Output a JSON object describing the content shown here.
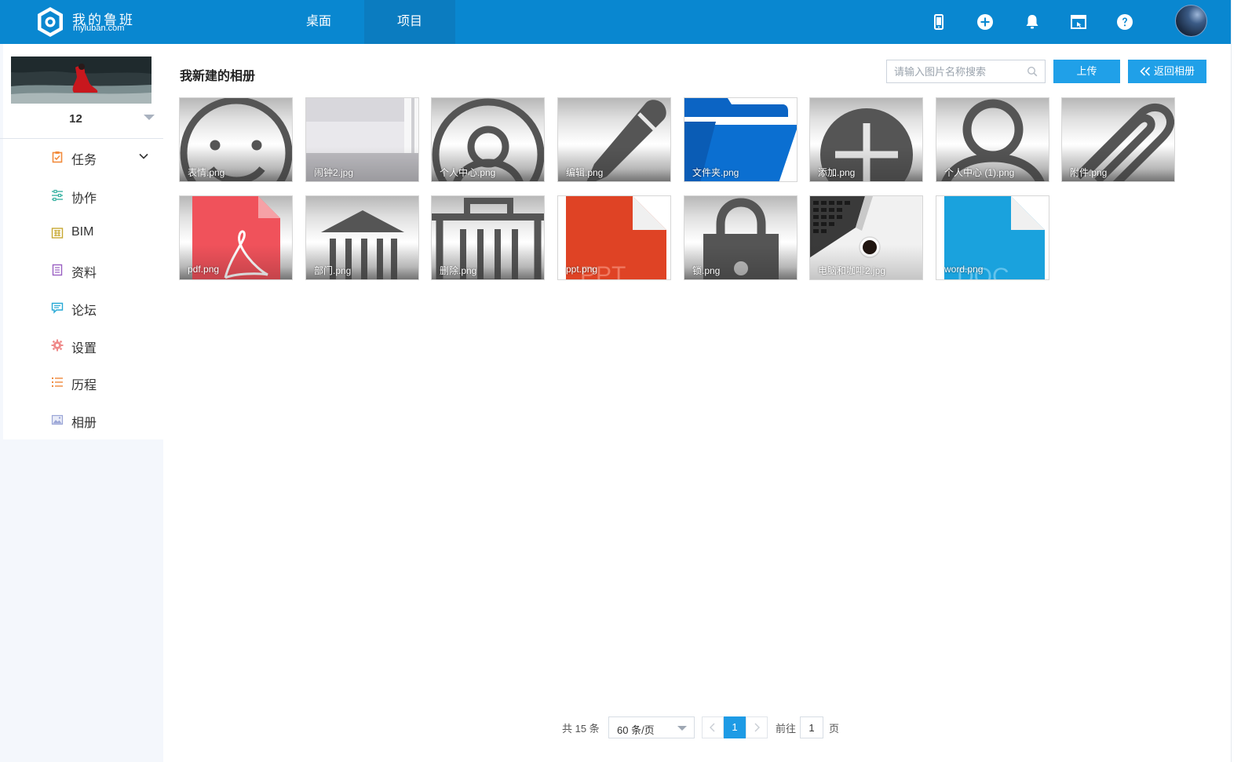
{
  "header": {
    "brand_cn": "我的鲁班",
    "brand_en": "myluban.com",
    "tabs": [
      {
        "label": "桌面",
        "active": false
      },
      {
        "label": "项目",
        "active": true
      }
    ],
    "icons": [
      "mobile-icon",
      "plus-circle-icon",
      "bell-icon",
      "window-icon",
      "help-icon",
      "user-avatar"
    ],
    "accent_color": "#0987d0"
  },
  "sidebar": {
    "project_name": "12",
    "items": [
      {
        "label": "任务",
        "icon": "task-icon",
        "expandable": true
      },
      {
        "label": "协作",
        "icon": "collaborate-icon"
      },
      {
        "label": "BIM",
        "icon": "bim-icon"
      },
      {
        "label": "资料",
        "icon": "documents-icon"
      },
      {
        "label": "论坛",
        "icon": "forum-icon"
      },
      {
        "label": "设置",
        "icon": "settings-icon"
      },
      {
        "label": "历程",
        "icon": "history-icon"
      },
      {
        "label": "相册",
        "icon": "album-icon"
      }
    ]
  },
  "main": {
    "title": "我新建的相册",
    "search_placeholder": "请输入图片名称搜索",
    "upload_label": "上传",
    "back_label": "返回相册",
    "photos": [
      {
        "name": "表情.png",
        "icon": "smiley-icon"
      },
      {
        "name": "闹钟2.jpg",
        "icon": "alarm-photo"
      },
      {
        "name": "个人中心.png",
        "icon": "user-circle-icon"
      },
      {
        "name": "编辑.png",
        "icon": "pencil-icon"
      },
      {
        "name": "文件夹.png",
        "icon": "folder-icon"
      },
      {
        "name": "添加.png",
        "icon": "add-circle-icon"
      },
      {
        "name": "个人中心 (1).png",
        "icon": "user-icon"
      },
      {
        "name": "附件.png",
        "icon": "paperclip-icon"
      },
      {
        "name": "pdf.png",
        "icon": "pdf-file-icon"
      },
      {
        "name": "部门.png",
        "icon": "building-icon"
      },
      {
        "name": "删除.png",
        "icon": "trash-icon"
      },
      {
        "name": "ppt.png",
        "icon": "ppt-file-icon"
      },
      {
        "name": "锁.png",
        "icon": "lock-icon"
      },
      {
        "name": "电脑和咖啡2.jpg",
        "icon": "laptop-coffee-photo"
      },
      {
        "name": "word.png",
        "icon": "word-file-icon"
      }
    ]
  },
  "pagination": {
    "total": "共 15 条",
    "page_size": "60 条/页",
    "current_page": "1",
    "goto_label": "前往",
    "goto_value": "1",
    "page_unit": "页"
  }
}
